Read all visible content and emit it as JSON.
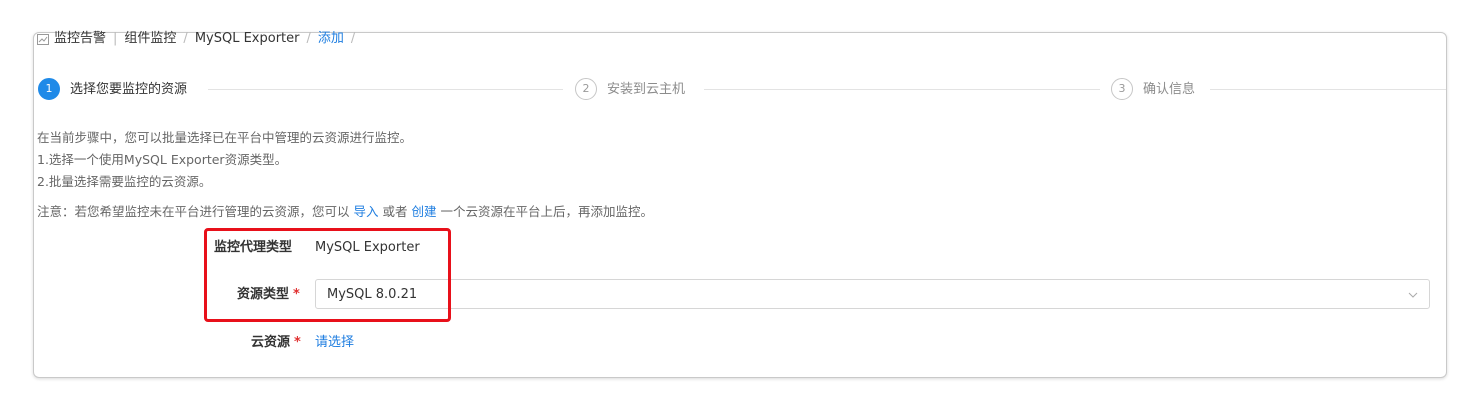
{
  "breadcrumb": {
    "items": [
      "监控告警",
      "组件监控",
      "MySQL Exporter",
      "添加"
    ],
    "separator": "/",
    "icon": "chart-icon"
  },
  "steps": [
    {
      "number": "1",
      "label": "选择您要监控的资源",
      "state": "active"
    },
    {
      "number": "2",
      "label": "安装到云主机",
      "state": "pending"
    },
    {
      "number": "3",
      "label": "确认信息",
      "state": "pending"
    }
  ],
  "description": {
    "lines": [
      "在当前步骤中，您可以批量选择已在平台中管理的云资源进行监控。",
      "1.选择一个使用MySQL Exporter资源类型。",
      "2.批量选择需要监控的云资源。"
    ],
    "note_prefix": "注意：若您希望监控未在平台进行管理的云资源，您可以",
    "note_import": "导入",
    "note_or": "或者",
    "note_create": "创建",
    "note_suffix": "一个云资源在平台上后，再添加监控。"
  },
  "form": {
    "agent_type_label": "监控代理类型",
    "agent_type_value": "MySQL Exporter",
    "resource_type_label": "资源类型",
    "resource_type_value": "MySQL 8.0.21",
    "cloud_resource_label": "云资源",
    "cloud_resource_link": "请选择",
    "required_mark": "*"
  },
  "colors": {
    "primary": "#1f8ae8",
    "link": "#1f7ee0",
    "highlight": "#e8101a",
    "required": "#e03030"
  }
}
